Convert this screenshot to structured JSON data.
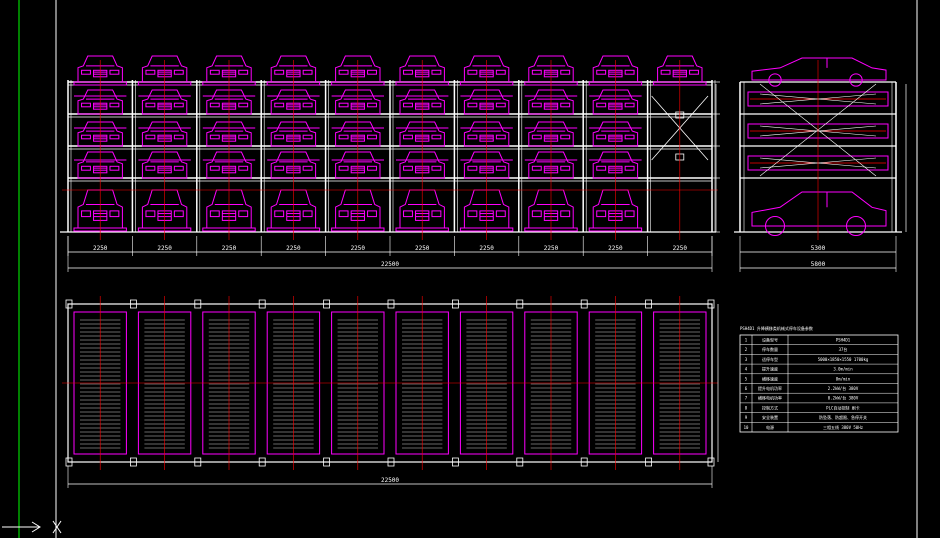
{
  "dimensions": {
    "front_bays": [
      "2250",
      "2250",
      "2250",
      "2250",
      "2250",
      "2250",
      "2250",
      "2250",
      "2250",
      "2250"
    ],
    "front_total": "22500",
    "side_inner": "5300",
    "side_outer": "5800",
    "plan_total": "22500"
  },
  "spec_table": {
    "title": "PSH4D1 升降横移类机械式停车设备参数",
    "rows": [
      [
        "1",
        "设备型号",
        "PSH4D1"
      ],
      [
        "2",
        "停车数量",
        "37台"
      ],
      [
        "3",
        "适停车型",
        "5000×1850×1550 1700kg"
      ],
      [
        "4",
        "提升速度",
        "3.0m/min"
      ],
      [
        "5",
        "横移速度",
        "8m/min"
      ],
      [
        "6",
        "提升电机功率",
        "2.2kW/台  380V"
      ],
      [
        "7",
        "横移电机功率",
        "0.2kW/台  380V"
      ],
      [
        "8",
        "控制方式",
        "PLC自动控制 刷卡"
      ],
      [
        "9",
        "安全装置",
        "防坠落、防超限、急停开关"
      ],
      [
        "10",
        "电源",
        "三相五线 380V 50Hz"
      ]
    ]
  },
  "colors": {
    "background": "#000000",
    "frame": "#ffffff",
    "structure": "#ff00ff",
    "axis": "#ff0000",
    "dimension": "#ffffff",
    "border": "#00ff00"
  },
  "icons": {
    "ucs": "ucs-axis-icon"
  }
}
